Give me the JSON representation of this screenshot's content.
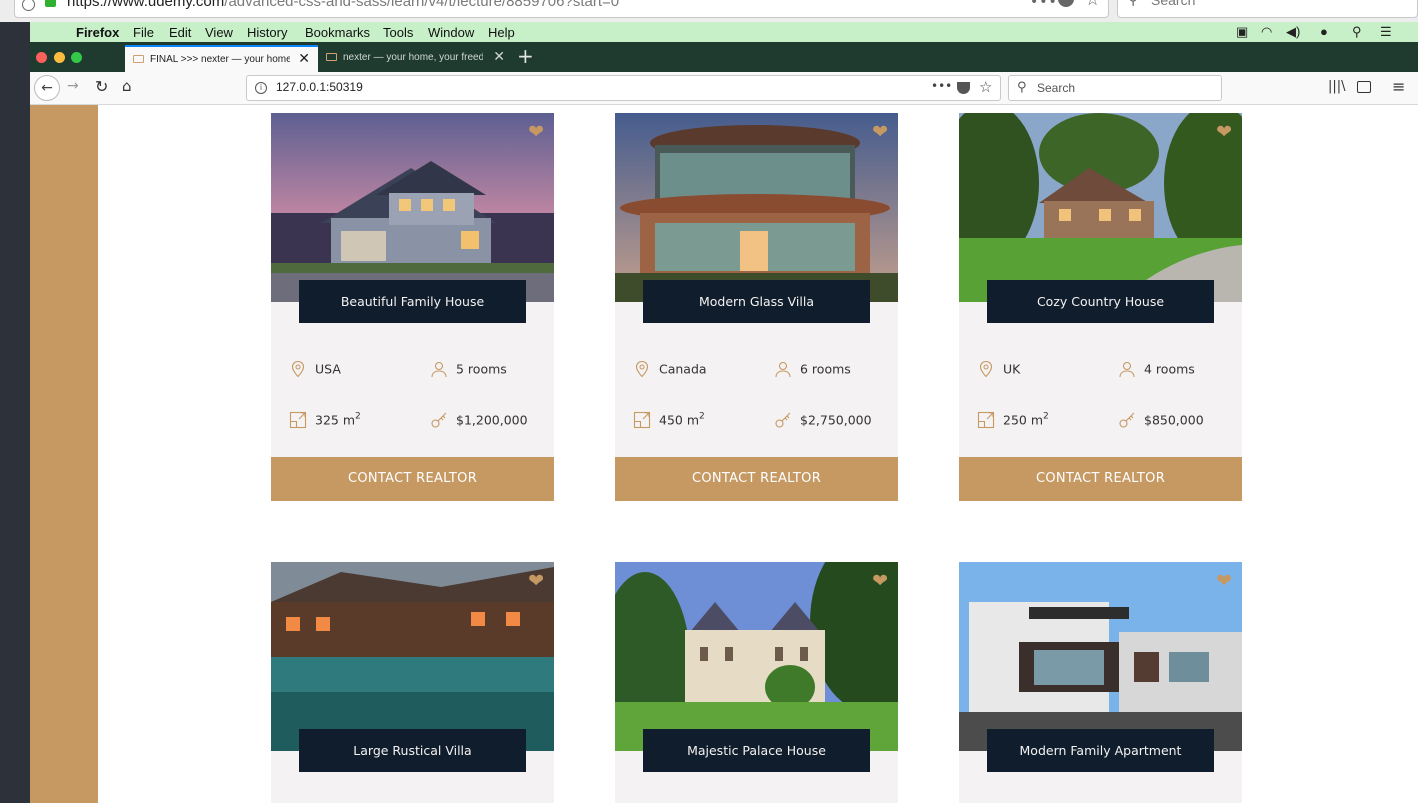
{
  "outer_browser": {
    "url_host": "https://www.udemy.com",
    "url_path": "/advanced-css-and-sass/learn/v4/t/lecture/8859706?start=0",
    "search_placeholder": "Search"
  },
  "menubar": {
    "app": "Firefox",
    "items": [
      "File",
      "Edit",
      "View",
      "History",
      "Bookmarks",
      "Tools",
      "Window",
      "Help"
    ]
  },
  "tabs": [
    {
      "title": "FINAL >>> nexter — your home",
      "active": true
    },
    {
      "title": "nexter — your home, your freedom",
      "active": false
    }
  ],
  "address_bar": {
    "url": "127.0.0.1:50319",
    "search_placeholder": "Search"
  },
  "colors": {
    "primary": "#c69963",
    "dark": "#101d2c",
    "card_bg": "#f4f2f2"
  },
  "homes": [
    {
      "name": "Beautiful Family House",
      "location": "USA",
      "rooms": "5 rooms",
      "area": "325 m",
      "price": "$1,200,000",
      "button": "CONTACT REALTOR"
    },
    {
      "name": "Modern Glass Villa",
      "location": "Canada",
      "rooms": "6 rooms",
      "area": "450 m",
      "price": "$2,750,000",
      "button": "CONTACT REALTOR"
    },
    {
      "name": "Cozy Country House",
      "location": "UK",
      "rooms": "4 rooms",
      "area": "250 m",
      "price": "$850,000",
      "button": "CONTACT REALTOR"
    },
    {
      "name": "Large Rustical Villa"
    },
    {
      "name": "Majestic Palace House"
    },
    {
      "name": "Modern Family Apartment"
    }
  ],
  "area_superscript": "2",
  "watermark": "Udemy"
}
